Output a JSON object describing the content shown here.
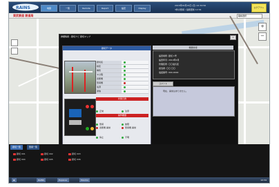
{
  "header": {
    "logo_text": "RAINS",
    "tabs": [
      "地図",
      "一覧",
      "Remote",
      "Report",
      "設定",
      "Display"
    ],
    "datetime": "2015年03月15日 (日) 12:34:56",
    "status": "3件の警報 / 最終更新 12:34",
    "logout_label": "ログアウト",
    "railway_name": "東武鉄道 鉄道局",
    "selector_value": "路線選択"
  },
  "dialog": {
    "title": "詳細情報 - 踏切ナビ 踏切マップ",
    "close_label": "×",
    "left_panel": {
      "title": "踏切データ",
      "rows": [
        {
          "label": "踏切名",
          "status": "green"
        },
        {
          "label": "線区",
          "status": "green"
        },
        {
          "label": "種別",
          "status": "green"
        },
        {
          "label": "キロ程",
          "status": "green"
        },
        {
          "label": "遮断機",
          "status": "green"
        },
        {
          "label": "警報機",
          "status": "red"
        },
        {
          "label": "電源",
          "status": "green"
        },
        {
          "label": "通信",
          "status": "green"
        }
      ],
      "section1": "状態凡例",
      "legend": [
        {
          "label": "正常",
          "color": "green"
        },
        {
          "label": "注意",
          "color": "green"
        },
        {
          "label": "警報",
          "color": "green"
        },
        {
          "label": "故障",
          "color": "green"
        },
        {
          "label": "停止",
          "color": "green"
        },
        {
          "label": "不明",
          "color": "green"
        }
      ],
      "section2": "操作履歴",
      "history": [
        {
          "label": "遮断機 異常",
          "color": "red"
        },
        {
          "label": "警報機 異常",
          "color": "red"
        }
      ]
    },
    "right_panel": {
      "title": "機器情報",
      "lines": [
        "設置場所: 踏切 1号",
        "設置年月: 2010年4月",
        "管理区所: 〇〇電気区",
        "担当者: 〇〇 〇〇",
        "電話番号: 000-0000"
      ],
      "comment_label": "コメント",
      "comment_text": "現在、異常はありません。"
    }
  },
  "bottom": {
    "tabs": [
      "踏切一覧",
      "警報一覧"
    ],
    "items": [
      "踏切 001",
      "踏切 002",
      "踏切 003",
      "踏切 004",
      "踏切 005",
      "踏切 006"
    ]
  },
  "taskbar": {
    "items": [
      "RAINS",
      "Explorer",
      "Monitor"
    ],
    "clock": "12:34"
  },
  "colors": {
    "header": "#1a3152",
    "alarm": "#cc2222",
    "normal": "#2eaa3c",
    "dialog_bg": "#111111"
  }
}
